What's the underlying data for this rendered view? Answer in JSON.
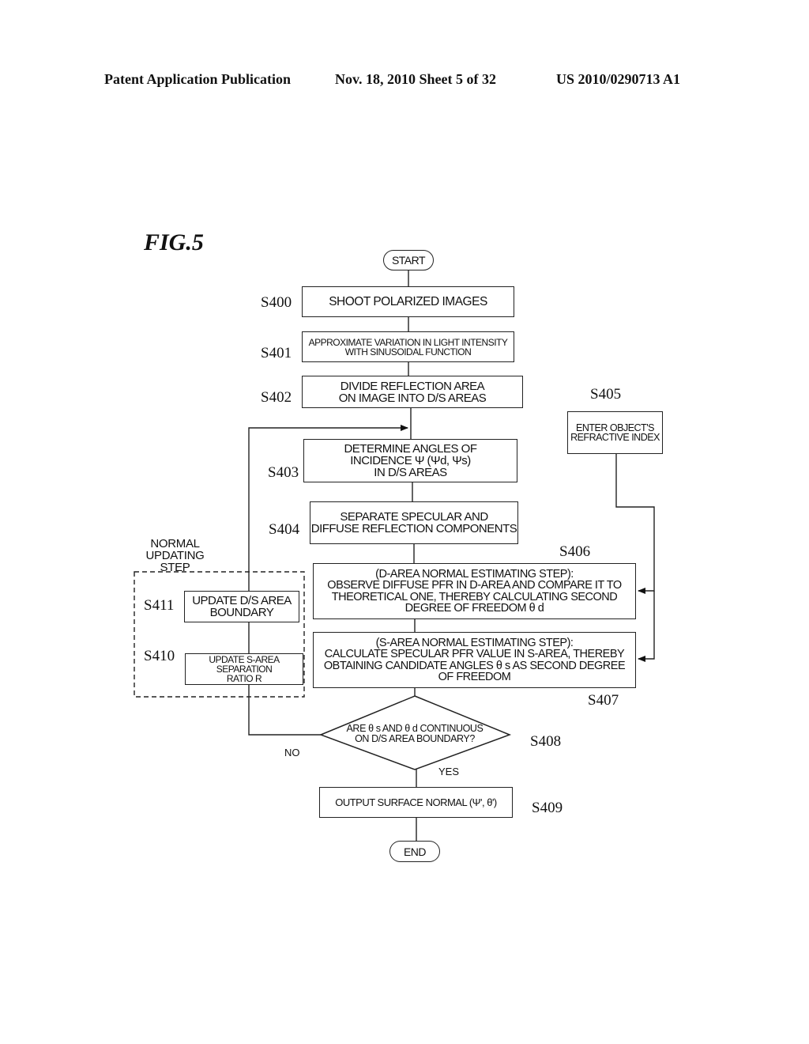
{
  "header": {
    "publication": "Patent Application Publication",
    "date_sheet": "Nov. 18, 2010   Sheet 5 of 32",
    "number": "US 2010/0290713 A1"
  },
  "figure": {
    "title": "FIG.5",
    "start": "START",
    "end": "END",
    "steps": {
      "s400": {
        "id": "S400",
        "text": "SHOOT POLARIZED IMAGES"
      },
      "s401": {
        "id": "S401",
        "text": "APPROXIMATE VARIATION IN LIGHT INTENSITY\nWITH SINUSOIDAL FUNCTION"
      },
      "s402": {
        "id": "S402",
        "text": "DIVIDE REFLECTION AREA\nON IMAGE INTO D/S AREAS"
      },
      "s403": {
        "id": "S403",
        "text": "DETERMINE ANGLES OF\nINCIDENCE Ψ (Ψd, Ψs)\nIN D/S AREAS"
      },
      "s404": {
        "id": "S404",
        "text": "SEPARATE SPECULAR AND\nDIFFUSE REFLECTION COMPONENTS"
      },
      "s405": {
        "id": "S405",
        "text": "ENTER OBJECT'S\nREFRACTIVE INDEX"
      },
      "s406": {
        "id": "S406",
        "text": "(D-AREA NORMAL ESTIMATING STEP):\nOBSERVE DIFFUSE PFR IN D-AREA AND COMPARE IT TO\nTHEORETICAL ONE, THEREBY CALCULATING SECOND\nDEGREE OF FREEDOM  θ d"
      },
      "s407": {
        "id": "S407",
        "text": "(S-AREA NORMAL ESTIMATING STEP):\nCALCULATE SPECULAR PFR VALUE IN S-AREA, THEREBY\nOBTAINING CANDIDATE ANGLES  θ s AS SECOND DEGREE\nOF FREEDOM"
      },
      "s408": {
        "id": "S408",
        "text": "ARE  θ s AND θ d CONTINUOUS\nON D/S AREA BOUNDARY?"
      },
      "s409": {
        "id": "S409",
        "text": "OUTPUT SURFACE NORMAL (Ψ',  θ')"
      },
      "s410": {
        "id": "S410",
        "text": "UPDATE S-AREA\nSEPARATION\nRATIO R"
      },
      "s411": {
        "id": "S411",
        "text": "UPDATE D/S AREA\nBOUNDARY"
      }
    },
    "group_label": "NORMAL\nUPDATING STEP",
    "yes_label": "YES",
    "no_label": "NO"
  }
}
